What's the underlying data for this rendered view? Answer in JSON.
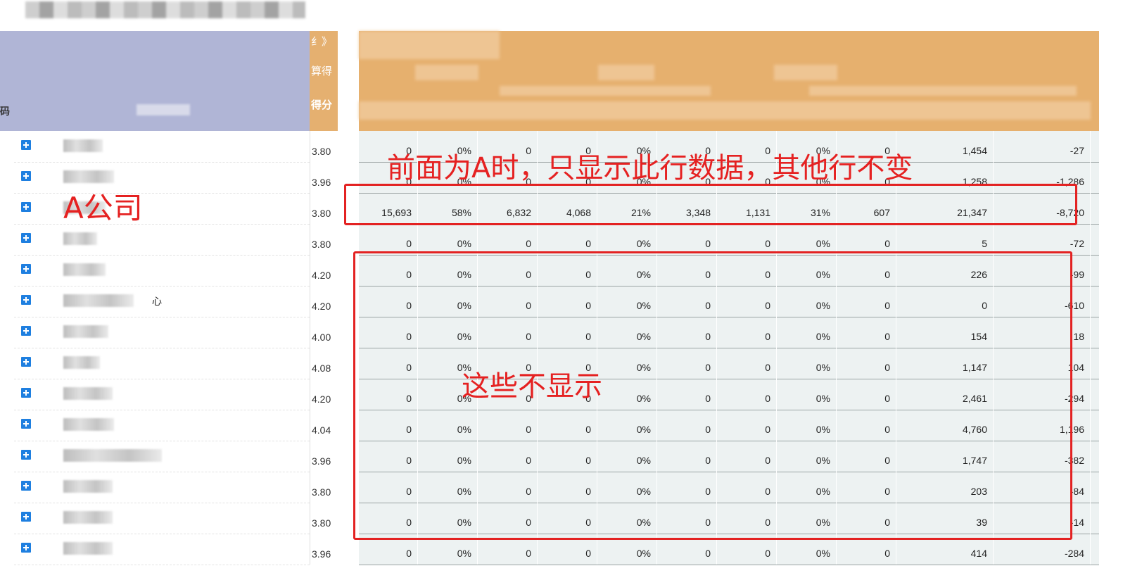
{
  "header": {
    "left_code_label": "码",
    "score_header_lines": [
      "纟》",
      "算得",
      "得分"
    ]
  },
  "annotations": {
    "company_label": "A公司",
    "top_note": "前面为A时，只显示此行数据，其他行不变",
    "hidden_note": "这些不显示"
  },
  "left_rows": [
    {
      "name_suffix": "",
      "score": "3.80"
    },
    {
      "name_suffix": "",
      "score": "3.96"
    },
    {
      "name_suffix": "",
      "score": "3.80"
    },
    {
      "name_suffix": "",
      "score": "3.80"
    },
    {
      "name_suffix": "",
      "score": "4.20"
    },
    {
      "name_suffix": "心",
      "score": "4.20"
    },
    {
      "name_suffix": "",
      "score": "4.00"
    },
    {
      "name_suffix": "",
      "score": "4.08"
    },
    {
      "name_suffix": "",
      "score": "4.20"
    },
    {
      "name_suffix": "",
      "score": "4.04"
    },
    {
      "name_suffix": "",
      "score": "3.96"
    },
    {
      "name_suffix": "",
      "score": "3.80"
    },
    {
      "name_suffix": "",
      "score": "3.80"
    },
    {
      "name_suffix": "",
      "score": "3.96"
    }
  ],
  "table": {
    "rows": [
      [
        "0",
        "0%",
        "0",
        "0",
        "0%",
        "0",
        "0",
        "0%",
        "0",
        "1,454",
        "-27"
      ],
      [
        "0",
        "0%",
        "0",
        "0",
        "0%",
        "0",
        "0",
        "0%",
        "0",
        "1,258",
        "-1,286"
      ],
      [
        "15,693",
        "58%",
        "6,832",
        "4,068",
        "21%",
        "3,348",
        "1,131",
        "31%",
        "607",
        "21,347",
        "-8,720"
      ],
      [
        "0",
        "0%",
        "0",
        "0",
        "0%",
        "0",
        "0",
        "0%",
        "0",
        "5",
        "-72"
      ],
      [
        "0",
        "0%",
        "0",
        "0",
        "0%",
        "0",
        "0",
        "0%",
        "0",
        "226",
        "-99"
      ],
      [
        "0",
        "0%",
        "0",
        "0",
        "0%",
        "0",
        "0",
        "0%",
        "0",
        "0",
        "-610"
      ],
      [
        "0",
        "0%",
        "0",
        "0",
        "0%",
        "0",
        "0",
        "0%",
        "0",
        "154",
        "18"
      ],
      [
        "0",
        "0%",
        "0",
        "0",
        "0%",
        "0",
        "0",
        "0%",
        "0",
        "1,147",
        "104"
      ],
      [
        "0",
        "0%",
        "0",
        "0",
        "0%",
        "0",
        "0",
        "0%",
        "0",
        "2,461",
        "-294"
      ],
      [
        "0",
        "0%",
        "0",
        "0",
        "0%",
        "0",
        "0",
        "0%",
        "0",
        "4,760",
        "1,196"
      ],
      [
        "0",
        "0%",
        "0",
        "0",
        "0%",
        "0",
        "0",
        "0%",
        "0",
        "1,747",
        "-382"
      ],
      [
        "0",
        "0%",
        "0",
        "0",
        "0%",
        "0",
        "0",
        "0%",
        "0",
        "203",
        "-84"
      ],
      [
        "0",
        "0%",
        "0",
        "0",
        "0%",
        "0",
        "0",
        "0%",
        "0",
        "39",
        "-14"
      ],
      [
        "0",
        "0%",
        "0",
        "0",
        "0%",
        "0",
        "0",
        "0%",
        "0",
        "414",
        "-284"
      ]
    ]
  },
  "colors": {
    "left_header_bg": "#b0b5d6",
    "right_header_bg": "#e6b06e",
    "table_bg": "#edf2f2",
    "annotation_red": "#e32222",
    "plus_icon_blue": "#1e7fe0"
  }
}
